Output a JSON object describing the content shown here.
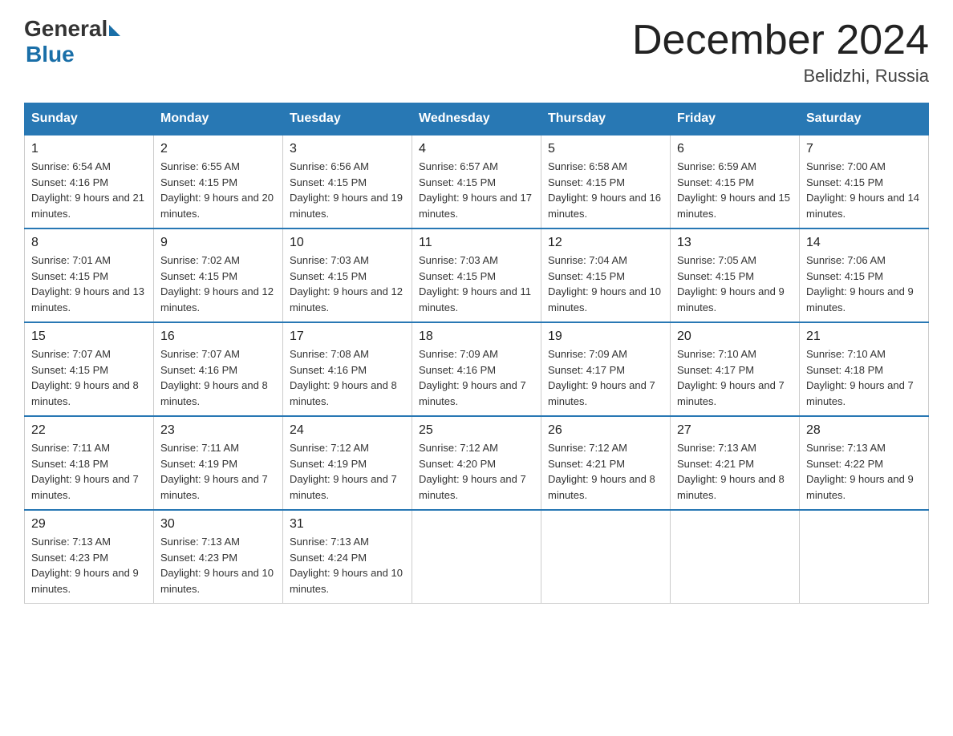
{
  "header": {
    "logo_general": "General",
    "logo_blue": "Blue",
    "month_title": "December 2024",
    "location": "Belidzhi, Russia"
  },
  "days_of_week": [
    "Sunday",
    "Monday",
    "Tuesday",
    "Wednesday",
    "Thursday",
    "Friday",
    "Saturday"
  ],
  "weeks": [
    [
      {
        "day": "1",
        "sunrise": "6:54 AM",
        "sunset": "4:16 PM",
        "daylight": "9 hours and 21 minutes."
      },
      {
        "day": "2",
        "sunrise": "6:55 AM",
        "sunset": "4:15 PM",
        "daylight": "9 hours and 20 minutes."
      },
      {
        "day": "3",
        "sunrise": "6:56 AM",
        "sunset": "4:15 PM",
        "daylight": "9 hours and 19 minutes."
      },
      {
        "day": "4",
        "sunrise": "6:57 AM",
        "sunset": "4:15 PM",
        "daylight": "9 hours and 17 minutes."
      },
      {
        "day": "5",
        "sunrise": "6:58 AM",
        "sunset": "4:15 PM",
        "daylight": "9 hours and 16 minutes."
      },
      {
        "day": "6",
        "sunrise": "6:59 AM",
        "sunset": "4:15 PM",
        "daylight": "9 hours and 15 minutes."
      },
      {
        "day": "7",
        "sunrise": "7:00 AM",
        "sunset": "4:15 PM",
        "daylight": "9 hours and 14 minutes."
      }
    ],
    [
      {
        "day": "8",
        "sunrise": "7:01 AM",
        "sunset": "4:15 PM",
        "daylight": "9 hours and 13 minutes."
      },
      {
        "day": "9",
        "sunrise": "7:02 AM",
        "sunset": "4:15 PM",
        "daylight": "9 hours and 12 minutes."
      },
      {
        "day": "10",
        "sunrise": "7:03 AM",
        "sunset": "4:15 PM",
        "daylight": "9 hours and 12 minutes."
      },
      {
        "day": "11",
        "sunrise": "7:03 AM",
        "sunset": "4:15 PM",
        "daylight": "9 hours and 11 minutes."
      },
      {
        "day": "12",
        "sunrise": "7:04 AM",
        "sunset": "4:15 PM",
        "daylight": "9 hours and 10 minutes."
      },
      {
        "day": "13",
        "sunrise": "7:05 AM",
        "sunset": "4:15 PM",
        "daylight": "9 hours and 9 minutes."
      },
      {
        "day": "14",
        "sunrise": "7:06 AM",
        "sunset": "4:15 PM",
        "daylight": "9 hours and 9 minutes."
      }
    ],
    [
      {
        "day": "15",
        "sunrise": "7:07 AM",
        "sunset": "4:15 PM",
        "daylight": "9 hours and 8 minutes."
      },
      {
        "day": "16",
        "sunrise": "7:07 AM",
        "sunset": "4:16 PM",
        "daylight": "9 hours and 8 minutes."
      },
      {
        "day": "17",
        "sunrise": "7:08 AM",
        "sunset": "4:16 PM",
        "daylight": "9 hours and 8 minutes."
      },
      {
        "day": "18",
        "sunrise": "7:09 AM",
        "sunset": "4:16 PM",
        "daylight": "9 hours and 7 minutes."
      },
      {
        "day": "19",
        "sunrise": "7:09 AM",
        "sunset": "4:17 PM",
        "daylight": "9 hours and 7 minutes."
      },
      {
        "day": "20",
        "sunrise": "7:10 AM",
        "sunset": "4:17 PM",
        "daylight": "9 hours and 7 minutes."
      },
      {
        "day": "21",
        "sunrise": "7:10 AM",
        "sunset": "4:18 PM",
        "daylight": "9 hours and 7 minutes."
      }
    ],
    [
      {
        "day": "22",
        "sunrise": "7:11 AM",
        "sunset": "4:18 PM",
        "daylight": "9 hours and 7 minutes."
      },
      {
        "day": "23",
        "sunrise": "7:11 AM",
        "sunset": "4:19 PM",
        "daylight": "9 hours and 7 minutes."
      },
      {
        "day": "24",
        "sunrise": "7:12 AM",
        "sunset": "4:19 PM",
        "daylight": "9 hours and 7 minutes."
      },
      {
        "day": "25",
        "sunrise": "7:12 AM",
        "sunset": "4:20 PM",
        "daylight": "9 hours and 7 minutes."
      },
      {
        "day": "26",
        "sunrise": "7:12 AM",
        "sunset": "4:21 PM",
        "daylight": "9 hours and 8 minutes."
      },
      {
        "day": "27",
        "sunrise": "7:13 AM",
        "sunset": "4:21 PM",
        "daylight": "9 hours and 8 minutes."
      },
      {
        "day": "28",
        "sunrise": "7:13 AM",
        "sunset": "4:22 PM",
        "daylight": "9 hours and 9 minutes."
      }
    ],
    [
      {
        "day": "29",
        "sunrise": "7:13 AM",
        "sunset": "4:23 PM",
        "daylight": "9 hours and 9 minutes."
      },
      {
        "day": "30",
        "sunrise": "7:13 AM",
        "sunset": "4:23 PM",
        "daylight": "9 hours and 10 minutes."
      },
      {
        "day": "31",
        "sunrise": "7:13 AM",
        "sunset": "4:24 PM",
        "daylight": "9 hours and 10 minutes."
      },
      null,
      null,
      null,
      null
    ]
  ]
}
